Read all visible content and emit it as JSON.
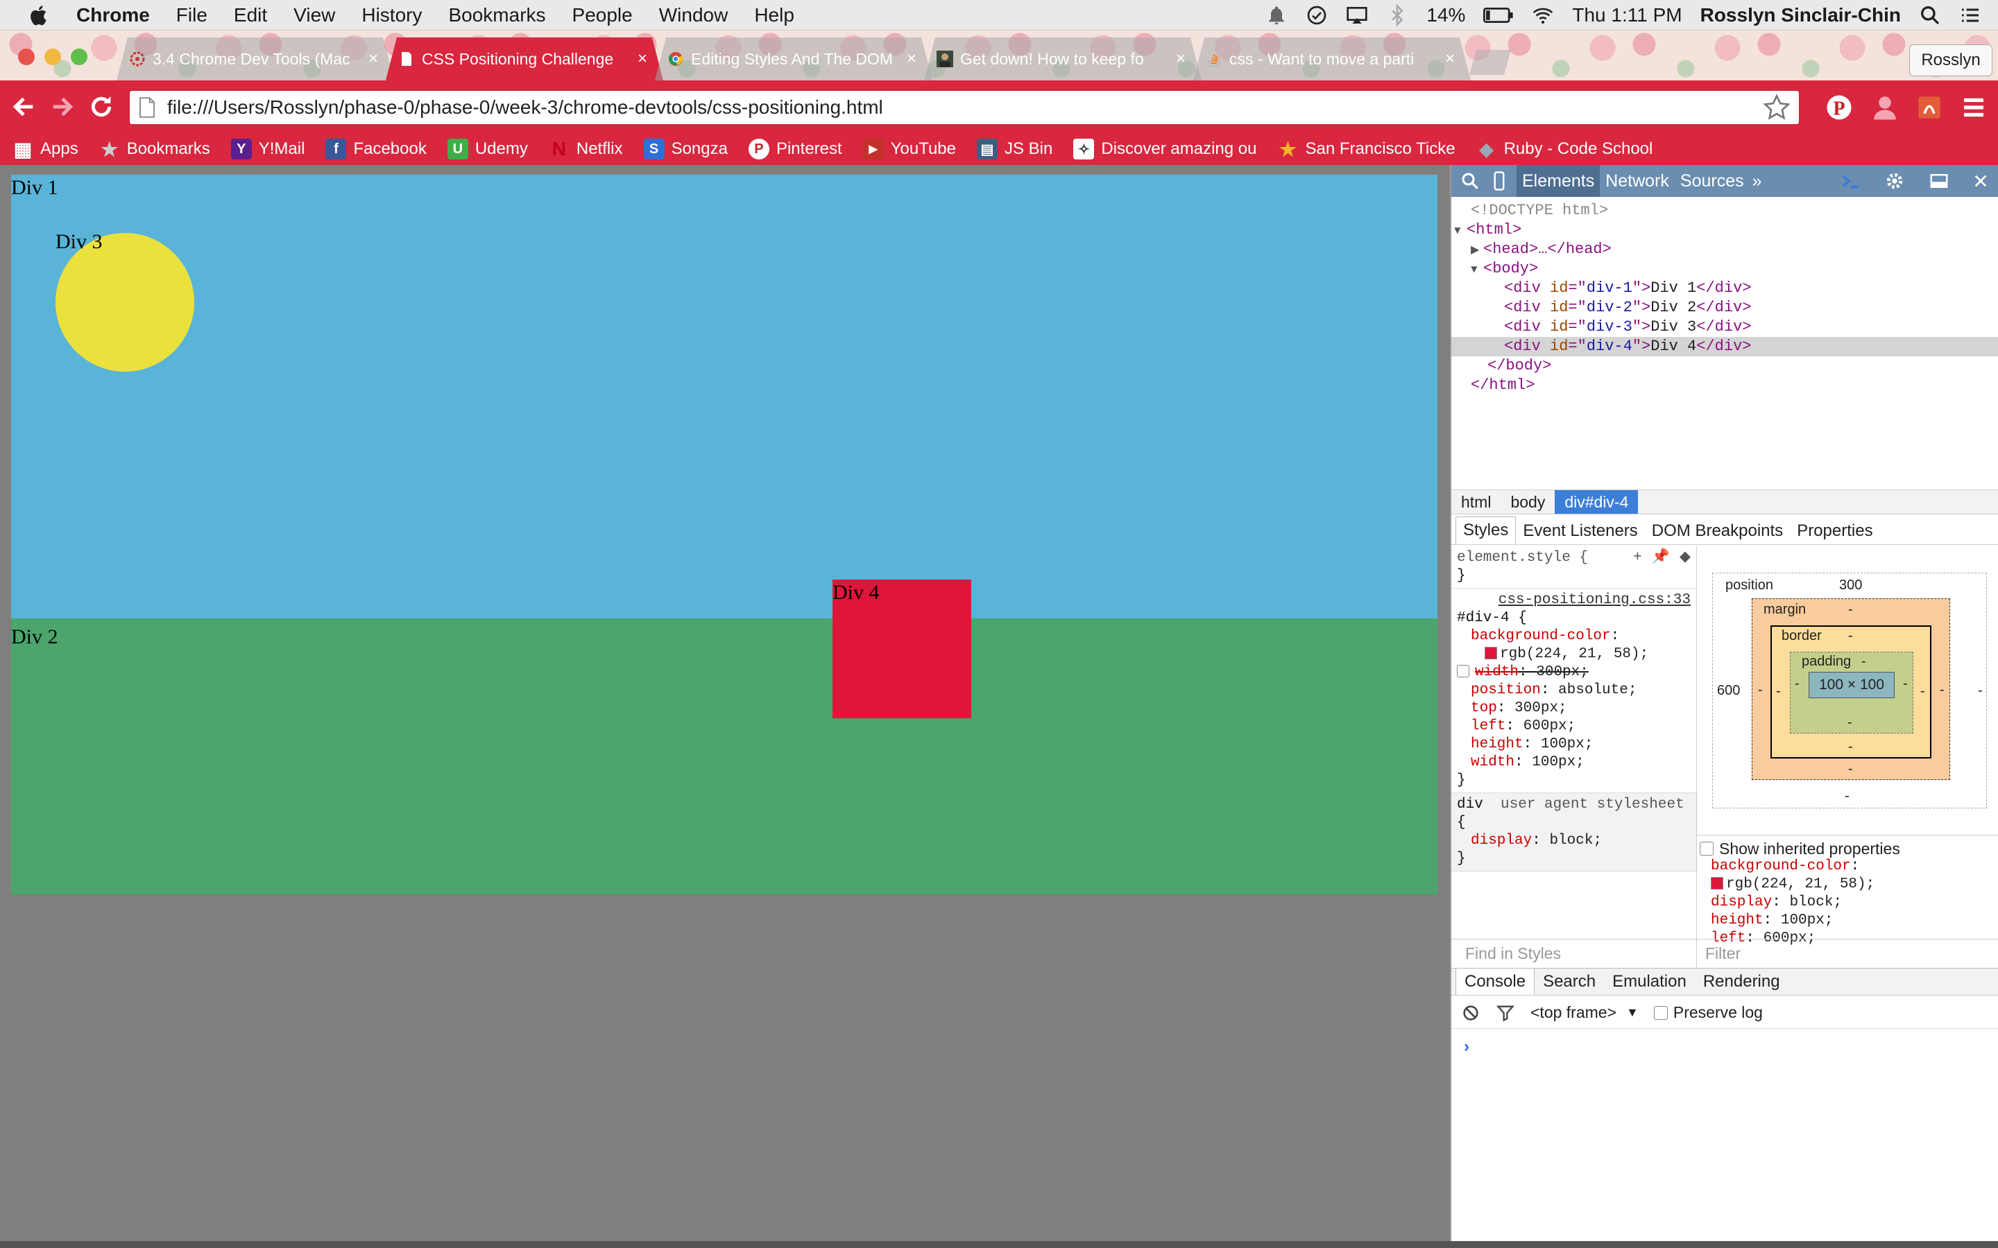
{
  "menubar": {
    "app_name": "Chrome",
    "items": [
      "File",
      "Edit",
      "View",
      "History",
      "Bookmarks",
      "People",
      "Window",
      "Help"
    ],
    "battery": "14%",
    "clock": "Thu 1:11 PM",
    "user": "Rosslyn Sinclair-Chin"
  },
  "tabs": [
    {
      "title": "3.4 Chrome Dev Tools (Mac",
      "icon": "settings-favicon"
    },
    {
      "title": "CSS Positioning Challenge",
      "icon": "page-favicon",
      "active": true
    },
    {
      "title": "Editing Styles And The DOM",
      "icon": "chrome-favicon"
    },
    {
      "title": "Get down! How to keep fo",
      "icon": "avatar-favicon"
    },
    {
      "title": "css - Want to move a parti",
      "icon": "stackoverflow-favicon"
    }
  ],
  "profile_button": "Rosslyn",
  "address_bar": {
    "url": "file:///Users/Rosslyn/phase-0/phase-0/week-3/chrome-devtools/css-positioning.html"
  },
  "bookmarks": [
    {
      "label": "Apps",
      "color": "#d8273f",
      "glyph": "▦"
    },
    {
      "label": "Bookmarks",
      "color": "#d8273f",
      "glyph": "★"
    },
    {
      "label": "Y!Mail",
      "color": "#5b1f8f",
      "glyph": "Y"
    },
    {
      "label": "Facebook",
      "color": "#3b5998",
      "glyph": "f"
    },
    {
      "label": "Udemy",
      "color": "#3fae49",
      "glyph": "U"
    },
    {
      "label": "Netflix",
      "color": "#c4001e",
      "glyph": "N"
    },
    {
      "label": "Songza",
      "color": "#2f6fd8",
      "glyph": "S"
    },
    {
      "label": "Pinterest",
      "color": "#c8232c",
      "glyph": "P"
    },
    {
      "label": "YouTube",
      "color": "#c4302b",
      "glyph": "▶"
    },
    {
      "label": "JS Bin",
      "color": "#3a5f80",
      "glyph": "▤"
    },
    {
      "label": "Discover amazing ou",
      "color": "#ffffff",
      "glyph": "✧"
    },
    {
      "label": "San Francisco Ticke",
      "color": "#f6b32b",
      "glyph": "★"
    },
    {
      "label": "Ruby - Code School",
      "color": "#9aa7b5",
      "glyph": "◆"
    }
  ],
  "page": {
    "div1": "Div 1",
    "div2": "Div 2",
    "div3": "Div 3",
    "div4": "Div 4",
    "colors": {
      "div1": "#5ab4d8",
      "div2": "#4ca56c",
      "div3": "#ebe13d",
      "div4": "#e0153a"
    }
  },
  "devtools": {
    "tabs": [
      "Elements",
      "Network",
      "Sources"
    ],
    "more": "»",
    "dom": {
      "doctype": "<!DOCTYPE html>",
      "html_open": "<html>",
      "head": "<head>…</head>",
      "body_open": "<body>",
      "body_close": "</body>",
      "html_close": "</html>",
      "divs": [
        {
          "id": "div-1",
          "text": "Div 1"
        },
        {
          "id": "div-2",
          "text": "Div 2"
        },
        {
          "id": "div-3",
          "text": "Div 3"
        },
        {
          "id": "div-4",
          "text": "Div 4"
        }
      ]
    },
    "breadcrumbs": [
      "html",
      "body",
      "div#div-4"
    ],
    "sub_tabs": [
      "Styles",
      "Event Listeners",
      "DOM Breakpoints",
      "Properties"
    ],
    "styles": {
      "element_style": "element.style {",
      "close_brace": "}",
      "source": "css-positioning.css:33",
      "selector": "#div-4 {",
      "rules": [
        {
          "prop": "background-color",
          "value": ""
        },
        {
          "prop": "",
          "value": "rgb(224, 21, 58);"
        },
        {
          "prop": "width",
          "value": "300px;"
        },
        {
          "prop": "position",
          "value": "absolute;"
        },
        {
          "prop": "top",
          "value": "300px;"
        },
        {
          "prop": "left",
          "value": "600px;"
        },
        {
          "prop": "height",
          "value": "100px;"
        },
        {
          "prop": "width",
          "value": "100px;"
        }
      ],
      "ua_selector": "div",
      "ua_label": "user agent stylesheet",
      "ua_open": "{",
      "ua_prop": "display",
      "ua_value": "block;"
    },
    "box_model": {
      "position_label": "position",
      "position_top": "300",
      "position_left": "600",
      "position_bottom": "-",
      "margin_label": "margin",
      "border_label": "border",
      "padding_label": "padding",
      "content": "100 × 100",
      "dash": "-"
    },
    "inherited": {
      "label": "Show inherited properties",
      "props": [
        {
          "prop": "background-color",
          "value": ""
        },
        {
          "prop": "",
          "value": "rgb(224, 21, 58);"
        },
        {
          "prop": "display",
          "value": "block;"
        },
        {
          "prop": "height",
          "value": "100px;"
        },
        {
          "prop": "left",
          "value": "600px;"
        }
      ]
    },
    "find_placeholder": "Find in Styles",
    "filter_placeholder": "Filter",
    "drawer_tabs": [
      "Console",
      "Search",
      "Emulation",
      "Rendering"
    ],
    "console": {
      "frame": "<top frame>",
      "dropdown": "▼",
      "preserve_log": "Preserve log",
      "prompt": "›"
    }
  }
}
